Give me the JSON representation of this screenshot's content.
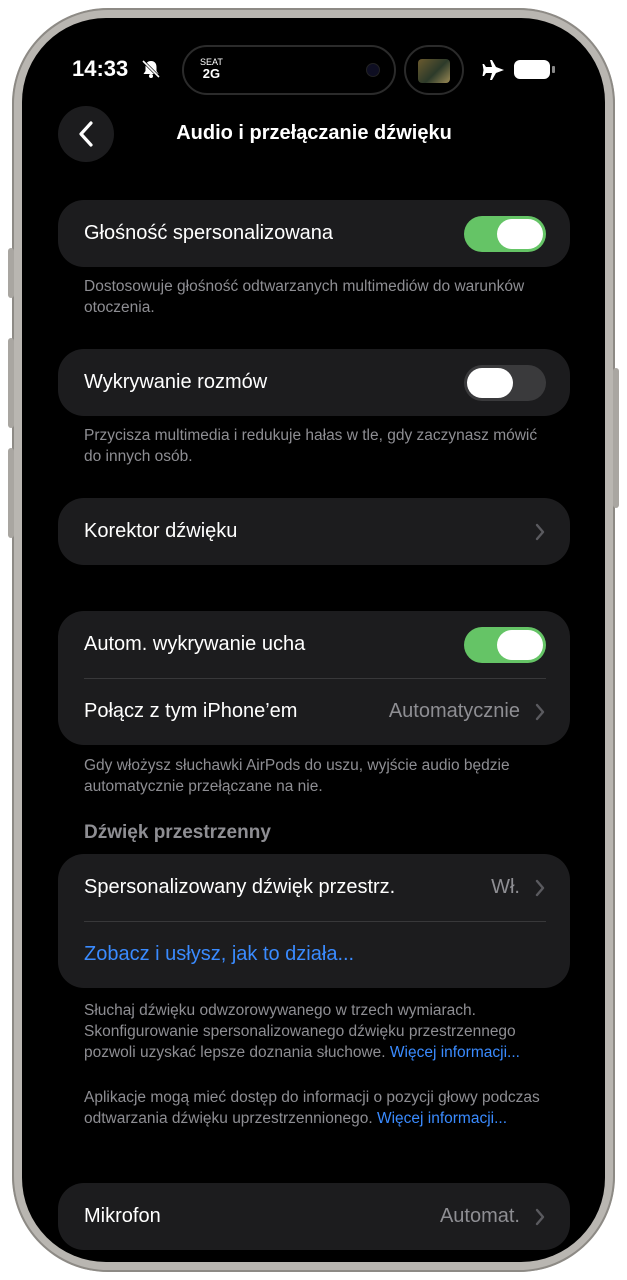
{
  "status_bar": {
    "time": "14:33",
    "seat_label": "SEAT",
    "seat_value": "2G",
    "bell_icon": "bell-slash-icon",
    "airplane_icon": "airplane-icon",
    "battery_icon": "battery-icon"
  },
  "nav": {
    "title": "Audio i przełączanie dźwięku",
    "back_icon": "chevron-left-icon"
  },
  "groups": {
    "personalized_volume": {
      "label": "Głośność spersonalizowana",
      "enabled": true,
      "footer": "Dostosowuje głośność odtwarzanych multimediów do warunków otoczenia."
    },
    "conversation_awareness": {
      "label": "Wykrywanie rozmów",
      "enabled": false,
      "footer": "Przycisza multimedia i redukuje hałas w tle, gdy zaczynasz mówić do innych osób."
    },
    "equalizer": {
      "label": "Korektor dźwięku"
    },
    "ear_detection": {
      "auto_label": "Autom. wykrywanie ucha",
      "auto_enabled": true,
      "connect_label": "Połącz z tym iPhone’em",
      "connect_value": "Automatycznie",
      "footer": "Gdy włożysz słuchawki AirPods do uszu, wyjście audio będzie automatycznie przełączane na nie."
    },
    "spatial": {
      "section_title": "Dźwięk przestrzenny",
      "personalized_label": "Spersonalizowany dźwięk przestrz.",
      "personalized_value": "Wł.",
      "demo_link": "Zobacz i usłysz, jak to działa...",
      "footer_1": "Słuchaj dźwięku odwzorowywanego w trzech wymiarach. Skonfigurowanie spersonalizowanego dźwięku przestrzennego pozwoli uzyskać lepsze doznania słuchowe.",
      "footer_1_link": "Więcej informacji...",
      "footer_2": "Aplikacje mogą mieć dostęp do informacji o pozycji głowy podczas odtwarzania dźwięku uprzestrzennionego.",
      "footer_2_link": "Więcej informacji..."
    },
    "microphone": {
      "label": "Mikrofon",
      "value": "Automat."
    }
  },
  "colors": {
    "toggle_on": "#65c466",
    "link": "#3a8bff",
    "cell": "#1c1c1e",
    "secondary_text": "#8e8e93"
  }
}
